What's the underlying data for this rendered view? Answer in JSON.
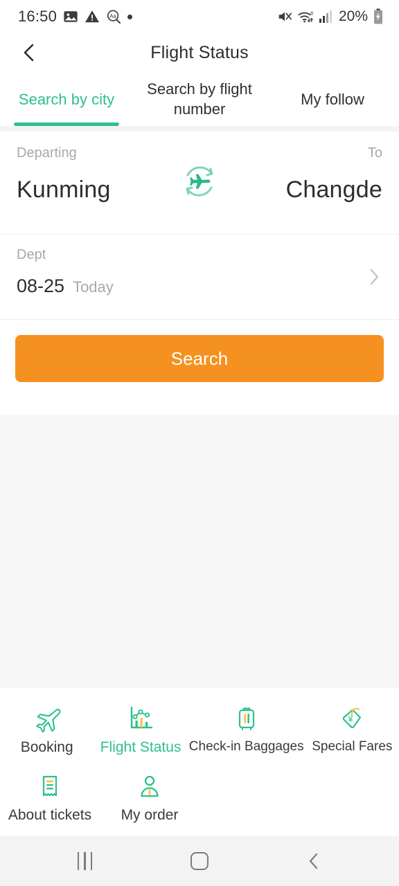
{
  "status_bar": {
    "time": "16:50",
    "left_icons": [
      "photo-icon",
      "warning-icon",
      "text-search-icon",
      "dot-indicator"
    ],
    "right_icons": [
      "mute-icon",
      "wifi-6-icon",
      "signal-icon"
    ],
    "battery_percent": "20%",
    "battery_state": "charging"
  },
  "header": {
    "title": "Flight Status",
    "back_icon": "chevron-left-icon"
  },
  "tabs": [
    {
      "label": "Search by city",
      "active": true
    },
    {
      "label": "Search by flight number",
      "active": false
    },
    {
      "label": "My follow",
      "active": false
    }
  ],
  "search_form": {
    "departing_label": "Departing",
    "departing_city": "Kunming",
    "to_label": "To",
    "to_city": "Changde",
    "swap_icon": "swap-plane-icon",
    "date_label": "Dept",
    "date_value": "08-25",
    "date_today": "Today",
    "date_chevron": "chevron-right-icon",
    "search_button": "Search"
  },
  "menu": {
    "row1": [
      {
        "label": "Booking",
        "icon": "airplane-icon",
        "active": false
      },
      {
        "label": "Flight Status",
        "icon": "chart-icon",
        "active": true
      },
      {
        "label": "Check-in Baggages",
        "icon": "suitcase-icon",
        "active": false
      },
      {
        "label": "Special Fares",
        "icon": "price-tag-icon",
        "active": false
      }
    ],
    "row2": [
      {
        "label": "About tickets",
        "icon": "receipt-icon",
        "active": false
      },
      {
        "label": "My order",
        "icon": "person-icon",
        "active": false
      }
    ]
  },
  "nav_bar": {
    "recents": "recents-icon",
    "home": "home-icon",
    "back": "back-icon"
  },
  "colors": {
    "accent_green": "#2ec08c",
    "accent_orange": "#f59120",
    "page_bg": "#f6f6f6",
    "text_primary": "#2d2d2d",
    "text_muted": "#a9a9a9"
  }
}
